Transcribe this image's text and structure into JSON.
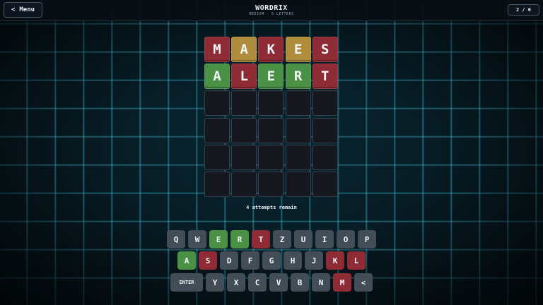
{
  "header": {
    "menu_arrow": "<",
    "menu_label": "Menu",
    "title": "WORDRIX",
    "subtitle": "MEDIUM · 5 LETTERS",
    "attempt_counter": "2 / 6"
  },
  "board": {
    "rows": [
      [
        {
          "l": "M",
          "s": "absent"
        },
        {
          "l": "A",
          "s": "present"
        },
        {
          "l": "K",
          "s": "absent"
        },
        {
          "l": "E",
          "s": "present"
        },
        {
          "l": "S",
          "s": "absent"
        }
      ],
      [
        {
          "l": "A",
          "s": "correct"
        },
        {
          "l": "L",
          "s": "absent"
        },
        {
          "l": "E",
          "s": "correct"
        },
        {
          "l": "R",
          "s": "correct"
        },
        {
          "l": "T",
          "s": "absent"
        }
      ],
      [
        {
          "l": "",
          "s": "empty"
        },
        {
          "l": "",
          "s": "empty"
        },
        {
          "l": "",
          "s": "empty"
        },
        {
          "l": "",
          "s": "empty"
        },
        {
          "l": "",
          "s": "empty"
        }
      ],
      [
        {
          "l": "",
          "s": "empty"
        },
        {
          "l": "",
          "s": "empty"
        },
        {
          "l": "",
          "s": "empty"
        },
        {
          "l": "",
          "s": "empty"
        },
        {
          "l": "",
          "s": "empty"
        }
      ],
      [
        {
          "l": "",
          "s": "empty"
        },
        {
          "l": "",
          "s": "empty"
        },
        {
          "l": "",
          "s": "empty"
        },
        {
          "l": "",
          "s": "empty"
        },
        {
          "l": "",
          "s": "empty"
        }
      ],
      [
        {
          "l": "",
          "s": "empty"
        },
        {
          "l": "",
          "s": "empty"
        },
        {
          "l": "",
          "s": "empty"
        },
        {
          "l": "",
          "s": "empty"
        },
        {
          "l": "",
          "s": "empty"
        }
      ]
    ]
  },
  "status_text": "4 attempts remain",
  "keyboard": {
    "rows": [
      [
        {
          "k": "Q",
          "s": "unused"
        },
        {
          "k": "W",
          "s": "unused"
        },
        {
          "k": "E",
          "s": "correct"
        },
        {
          "k": "R",
          "s": "correct"
        },
        {
          "k": "T",
          "s": "absent"
        },
        {
          "k": "Z",
          "s": "unused"
        },
        {
          "k": "U",
          "s": "unused"
        },
        {
          "k": "I",
          "s": "unused"
        },
        {
          "k": "O",
          "s": "unused"
        },
        {
          "k": "P",
          "s": "unused"
        }
      ],
      [
        {
          "k": "A",
          "s": "correct"
        },
        {
          "k": "S",
          "s": "absent"
        },
        {
          "k": "D",
          "s": "unused"
        },
        {
          "k": "F",
          "s": "unused"
        },
        {
          "k": "G",
          "s": "unused"
        },
        {
          "k": "H",
          "s": "unused"
        },
        {
          "k": "J",
          "s": "unused"
        },
        {
          "k": "K",
          "s": "absent"
        },
        {
          "k": "L",
          "s": "absent"
        }
      ],
      [
        {
          "k": "ENTER",
          "s": "wide"
        },
        {
          "k": "Y",
          "s": "unused"
        },
        {
          "k": "X",
          "s": "unused"
        },
        {
          "k": "C",
          "s": "unused"
        },
        {
          "k": "V",
          "s": "unused"
        },
        {
          "k": "B",
          "s": "unused"
        },
        {
          "k": "N",
          "s": "unused"
        },
        {
          "k": "M",
          "s": "absent"
        },
        {
          "k": "<",
          "s": "unused"
        }
      ]
    ]
  },
  "colors": {
    "correct": "#4a9045",
    "present": "#b08d3c",
    "absent": "#8e2b35",
    "unused_key": "#434d57",
    "empty_tile": "#14181e",
    "grid_glow": "#46d2f0"
  }
}
